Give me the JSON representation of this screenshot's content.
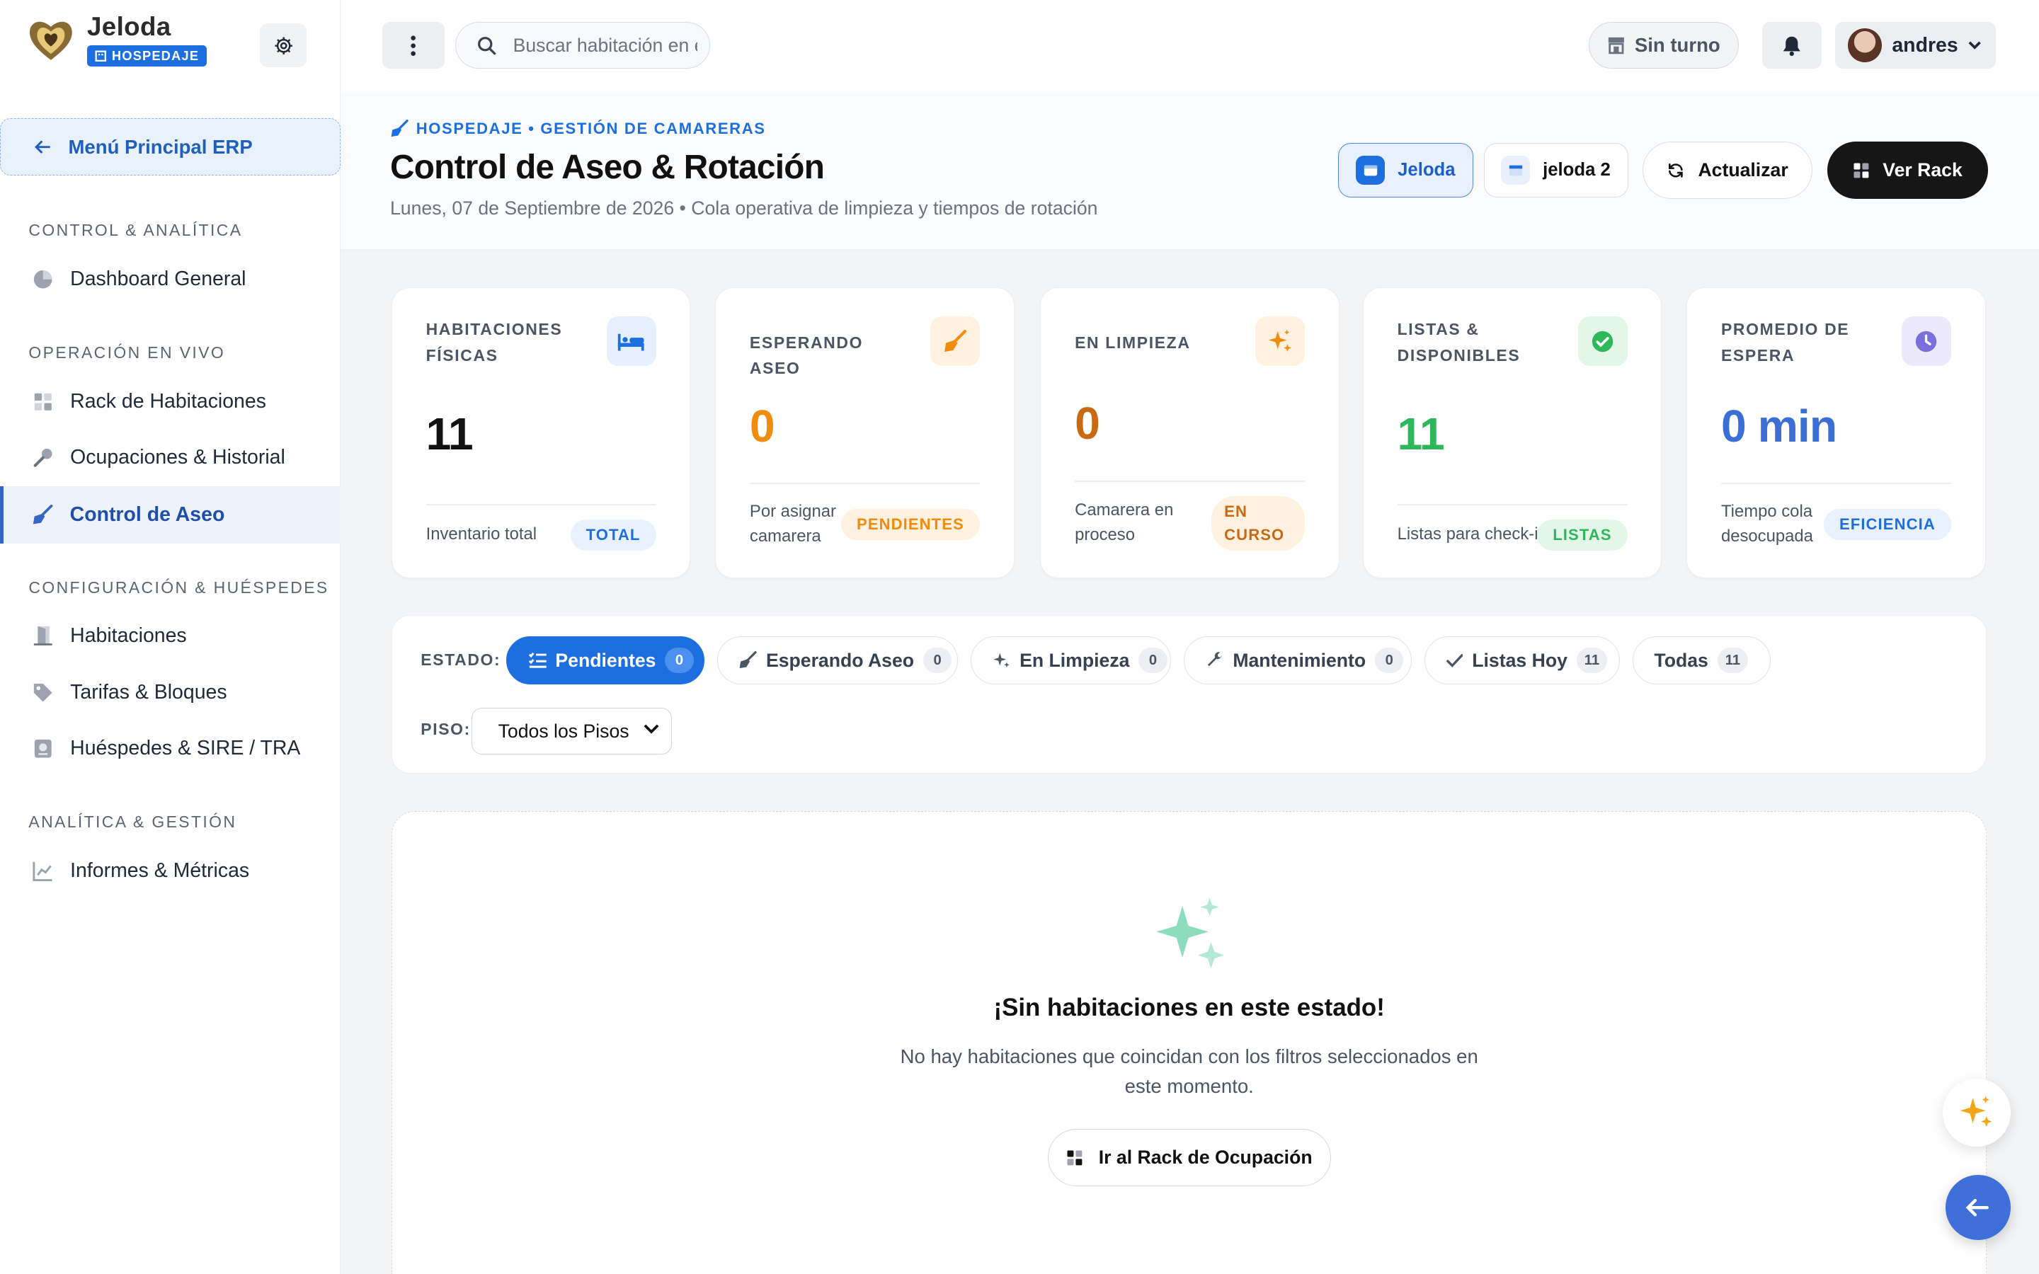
{
  "brand": {
    "name": "Jeloda",
    "badge": "HOSPEDAJE"
  },
  "sidebar": {
    "main_menu": "Menú Principal ERP",
    "sections": [
      {
        "title": "CONTROL & ANALÍTICA",
        "items": [
          {
            "label": "Dashboard General",
            "icon": "pie-chart-icon"
          }
        ]
      },
      {
        "title": "OPERACIÓN EN VIVO",
        "items": [
          {
            "label": "Rack de Habitaciones",
            "icon": "grid-icon"
          },
          {
            "label": "Ocupaciones & Historial",
            "icon": "key-icon"
          },
          {
            "label": "Control de Aseo",
            "icon": "broom-icon",
            "active": true
          }
        ]
      },
      {
        "title": "CONFIGURACIÓN & HUÉSPEDES",
        "items": [
          {
            "label": "Habitaciones",
            "icon": "door-icon"
          },
          {
            "label": "Tarifas & Bloques",
            "icon": "tag-icon"
          },
          {
            "label": "Huéspedes & SIRE / TRA",
            "icon": "passport-icon"
          }
        ]
      },
      {
        "title": "ANALÍTICA & GESTIÓN",
        "items": [
          {
            "label": "Informes & Métricas",
            "icon": "chart-icon"
          }
        ]
      }
    ]
  },
  "topbar": {
    "search_placeholder": "Buscar habitación en el rack...",
    "shift_label": "Sin turno",
    "user_name": "andres"
  },
  "header": {
    "breadcrumb": "HOSPEDAJE • GESTIÓN DE CAMARERAS",
    "title": "Control de Aseo & Rotación",
    "subtitle": "Lunes, 07 de Septiembre de 2026 • Cola operativa de limpieza y tiempos de rotación",
    "hotel_1": "Jeloda",
    "hotel_2": "jeloda 2",
    "refresh_label": "Actualizar",
    "rack_label": "Ver Rack"
  },
  "stats": [
    {
      "label": "HABITACIONES FÍSICAS",
      "value": "11",
      "foot": "Inventario total",
      "pill": "TOTAL",
      "color": "#111111",
      "icon": "bed-icon"
    },
    {
      "label": "ESPERANDO ASEO",
      "value": "0",
      "foot": "Por asignar camarera",
      "pill": "PENDIENTES",
      "color": "#f28c0f",
      "icon": "broom-icon"
    },
    {
      "label": "EN LIMPIEZA",
      "value": "0",
      "foot": "Camarera en proceso",
      "pill": "EN CURSO",
      "color": "#c96a12",
      "icon": "sparkles-icon"
    },
    {
      "label": "LISTAS & DISPONIBLES",
      "value": "11",
      "foot": "Listas para check-in",
      "pill": "LISTAS",
      "color": "#2fb85b",
      "icon": "check-circle-icon"
    },
    {
      "label": "PROMEDIO DE ESPERA",
      "value": "0 min",
      "foot": "Tiempo cola desocupada",
      "pill": "EFICIENCIA",
      "color": "#3b6fd6",
      "icon": "clock-icon"
    }
  ],
  "filters": {
    "status_label": "ESTADO:",
    "floor_label": "PISO:",
    "floor_value": "Todos los Pisos",
    "chips": [
      {
        "label": "Pendientes",
        "count": "0",
        "active": true
      },
      {
        "label": "Esperando Aseo",
        "count": "0"
      },
      {
        "label": "En Limpieza",
        "count": "0"
      },
      {
        "label": "Mantenimiento",
        "count": "0"
      },
      {
        "label": "Listas Hoy",
        "count": "11"
      },
      {
        "label": "Todas",
        "count": "11"
      }
    ]
  },
  "empty": {
    "title": "¡Sin habitaciones en este estado!",
    "description": "No hay habitaciones que coincidan con los filtros seleccionados en este momento.",
    "button": "Ir al Rack de Ocupación"
  },
  "colors": {
    "accent": "#1d6fe0",
    "dark": "#161616"
  }
}
